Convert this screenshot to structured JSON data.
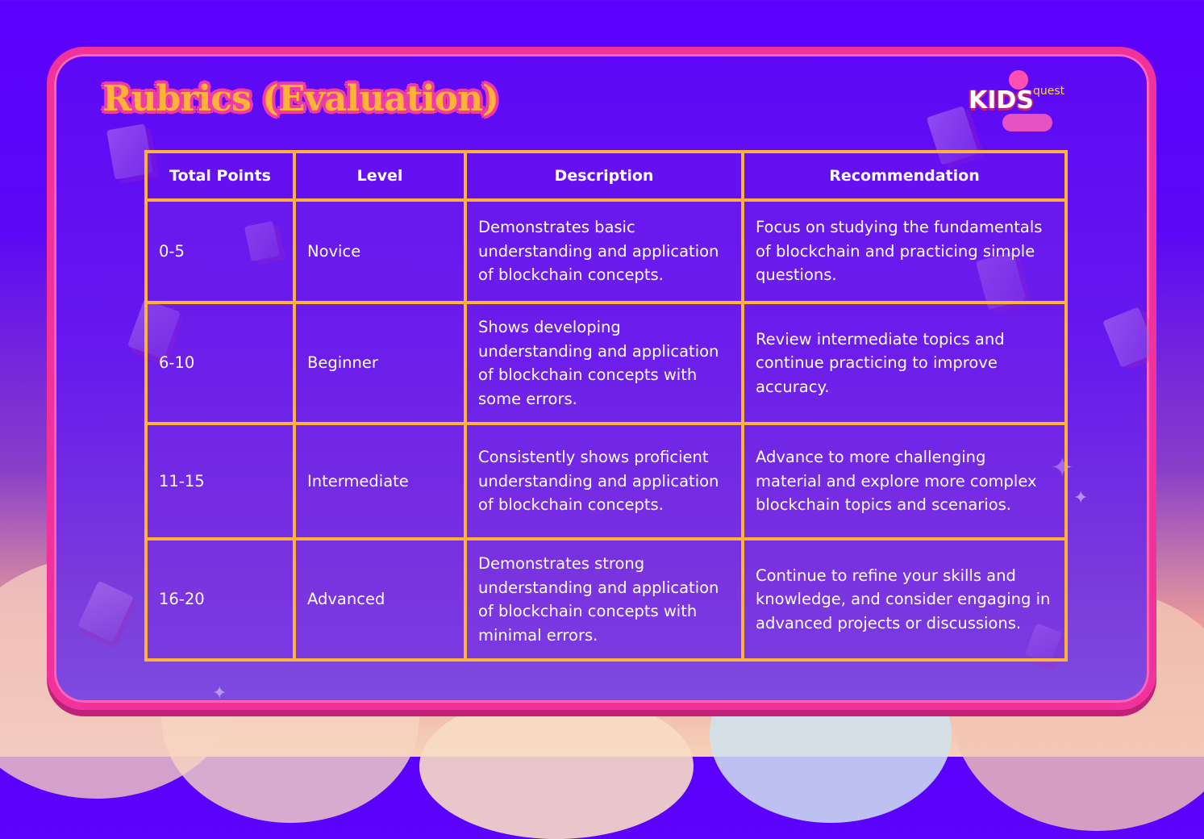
{
  "title": "Rubrics (Evaluation)",
  "logo": {
    "main": "KIDS",
    "sub": "quest"
  },
  "table": {
    "headers": [
      "Total Points",
      "Level",
      "Description",
      "Recommendation"
    ],
    "rows": [
      {
        "points": "0-5",
        "level": "Novice",
        "description": "Demonstrates basic understanding and application of blockchain concepts.",
        "recommendation": "Focus on studying the fundamentals of blockchain and practicing simple questions."
      },
      {
        "points": "6-10",
        "level": "Beginner",
        "description": "Shows developing understanding and application of blockchain concepts with some errors.",
        "recommendation": "Review intermediate topics and continue practicing to improve accuracy."
      },
      {
        "points": "11-15",
        "level": "Intermediate",
        "description": "Consistently shows proficient understanding and application of blockchain concepts.",
        "recommendation": "Advance to more challenging material and explore more complex blockchain topics and scenarios."
      },
      {
        "points": "16-20",
        "level": "Advanced",
        "description": "Demonstrates strong understanding and application of blockchain concepts with minimal errors.",
        "recommendation": "Continue to refine your skills and knowledge, and consider engaging in advanced projects or discussions."
      }
    ]
  },
  "colors": {
    "frame_border": "#f0329a",
    "table_border": "#ffb23a",
    "title_fill": "#ffb23a",
    "background_top": "#5b00ff"
  },
  "icons": [
    "sparkle-icon",
    "book-icon",
    "cloud-decoration"
  ]
}
